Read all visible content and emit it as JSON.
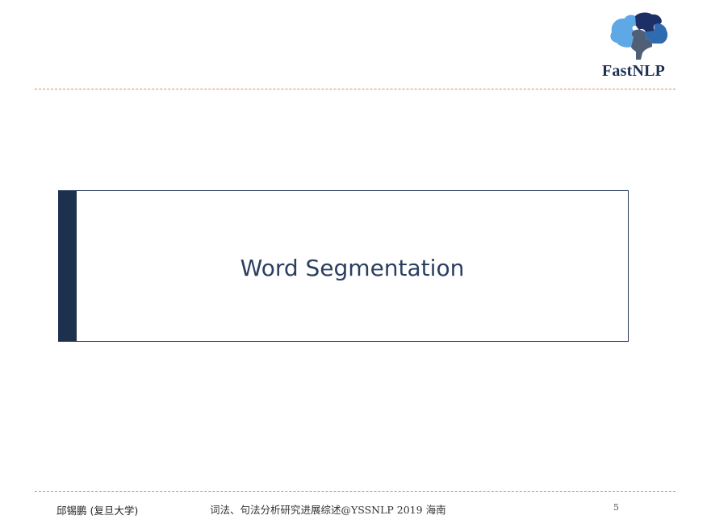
{
  "logo": {
    "text": "FastNLP",
    "icon": "brain-puzzle-icon",
    "colors": {
      "light_blue": "#5ea8e6",
      "mid_blue": "#2f6bb0",
      "dark_navy": "#1c2f67",
      "slate": "#4f5f75"
    }
  },
  "section": {
    "title": "Word Segmentation",
    "bar_color": "#1d314f",
    "border_color": "#22365a"
  },
  "footer": {
    "author": "邱锡鹏 (复旦大学)",
    "talk": "词法、句法分析研究进展综述@YSSNLP 2019 海南",
    "page_number": "5"
  },
  "colors": {
    "accent_dashed_rule": "#e6884d",
    "title_text": "#2b3f61"
  }
}
